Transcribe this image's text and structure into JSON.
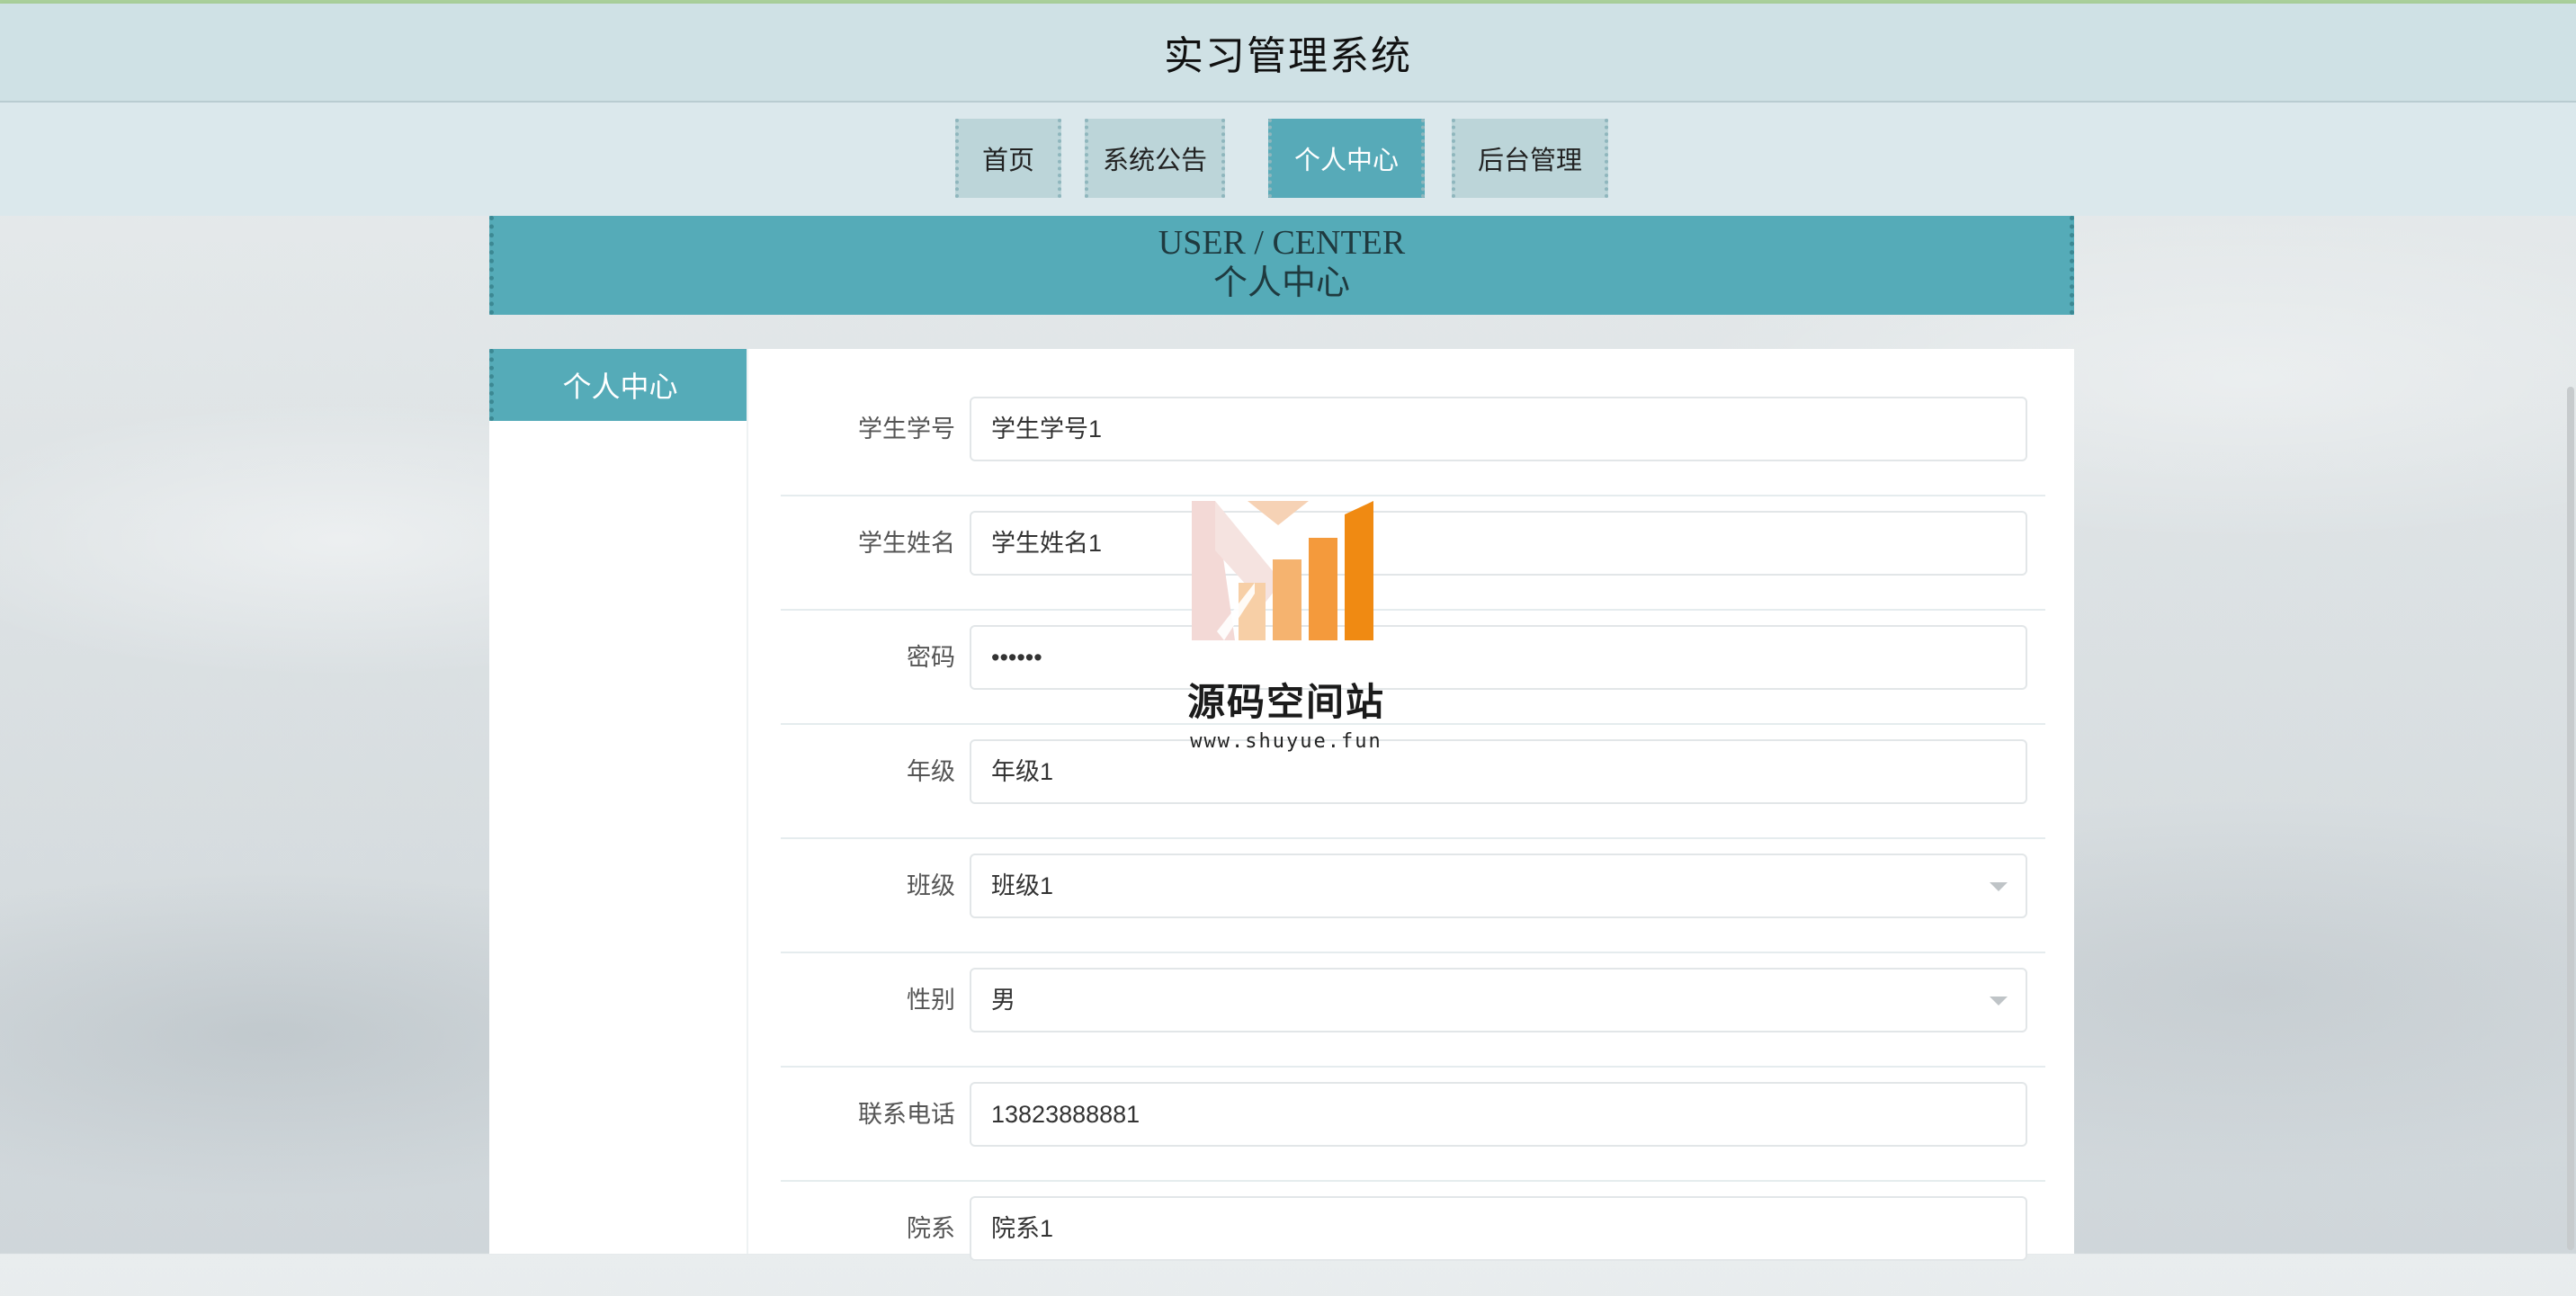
{
  "header": {
    "title": "实习管理系统"
  },
  "nav": {
    "items": [
      {
        "label": "首页"
      },
      {
        "label": "系统公告"
      },
      {
        "label": "个人中心"
      },
      {
        "label": "后台管理"
      }
    ]
  },
  "banner": {
    "en": "USER / CENTER",
    "cn": "个人中心"
  },
  "sidebar": {
    "active_label": "个人中心"
  },
  "form": {
    "rows": [
      {
        "label": "学生学号",
        "value": "学生学号1"
      },
      {
        "label": "学生姓名",
        "value": "学生姓名1"
      },
      {
        "label": "密码",
        "value": "••••••"
      },
      {
        "label": "年级",
        "value": "年级1"
      },
      {
        "label": "班级",
        "value": "班级1"
      },
      {
        "label": "性别",
        "value": "男"
      },
      {
        "label": "联系电话",
        "value": "13823888881"
      },
      {
        "label": "院系",
        "value": "院系1"
      }
    ]
  },
  "watermark": {
    "name": "源码空间站",
    "url": "www.shuyue.fun"
  },
  "colors": {
    "accent": "#55abb8",
    "header_bg": "#cfe1e5",
    "nav_bg": "#dbe8ec"
  }
}
